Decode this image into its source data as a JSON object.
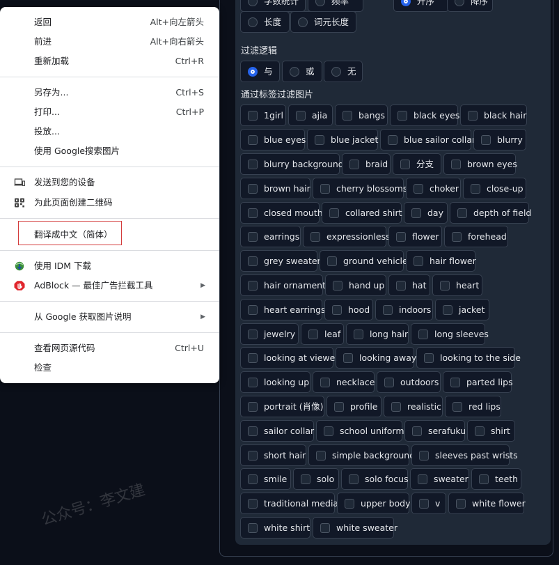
{
  "watermark": "公众号：李文建",
  "filter_panel": {
    "partial_top_left": [
      "字数统计",
      "频率"
    ],
    "partial_top_right": [
      "升序",
      "降序"
    ],
    "sort_by_row2": [
      "长度",
      "词元长度"
    ],
    "logic_title": "过滤逻辑",
    "logic_options": [
      "与",
      "或",
      "无"
    ],
    "logic_selected": "与",
    "tags_title": "通过标签过滤图片",
    "tags": [
      "1girl",
      "ajia",
      "bangs",
      "black eyes",
      "black hair",
      "blue eyes",
      "blue jacket",
      "blue sailor collar",
      "blurry",
      "blurry background",
      "braid",
      "分支",
      "brown eyes",
      "brown hair",
      "cherry blossoms",
      "choker",
      "close-up",
      "closed mouth",
      "collared shirt",
      "day",
      "depth of field",
      "earrings",
      "expressionless",
      "flower",
      "forehead",
      "grey sweater",
      "ground vehicle",
      "hair flower",
      "hair ornament",
      "hand up",
      "hat",
      "heart",
      "heart earrings",
      "hood",
      "indoors",
      "jacket",
      "jewelry",
      "leaf",
      "long hair",
      "long sleeves",
      "looking at viewer",
      "looking away",
      "looking to the side",
      "looking up",
      "necklace",
      "outdoors",
      "parted lips",
      "portrait (肖像)",
      "profile",
      "realistic",
      "red lips",
      "sailor collar",
      "school uniform",
      "serafuku",
      "shirt",
      "short hair",
      "simple background",
      "sleeves past wrists",
      "smile",
      "solo",
      "solo focus",
      "sweater",
      "teeth",
      "traditional media",
      "upper body",
      "v",
      "white flower",
      "white shirt",
      "white sweater"
    ]
  },
  "context_menu": {
    "items": [
      {
        "label": "返回",
        "shortcut": "Alt+向左箭头"
      },
      {
        "label": "前进",
        "shortcut": "Alt+向右箭头"
      },
      {
        "label": "重新加载",
        "shortcut": "Ctrl+R"
      },
      {
        "label": "另存为...",
        "shortcut": "Ctrl+S"
      },
      {
        "label": "打印...",
        "shortcut": "Ctrl+P"
      },
      {
        "label": "投放..."
      },
      {
        "label": "使用 Google搜索图片"
      },
      {
        "label": "发送到您的设备",
        "icon": "device-icon"
      },
      {
        "label": "为此页面创建二维码",
        "icon": "qr-code-icon"
      },
      {
        "label": "翻译成中文（简体）"
      },
      {
        "label": "使用 IDM 下载",
        "icon": "idm-icon"
      },
      {
        "label": "AdBlock — 最佳广告拦截工具",
        "icon": "adblock-icon",
        "submenu": true
      },
      {
        "label": "从 Google 获取图片说明",
        "submenu": true
      },
      {
        "label": "查看网页源代码",
        "shortcut": "Ctrl+U"
      },
      {
        "label": "检查"
      }
    ]
  },
  "colors": {
    "accent": "#2563eb",
    "highlight_border": "#d33b3b",
    "adblock": "#e0242b"
  }
}
